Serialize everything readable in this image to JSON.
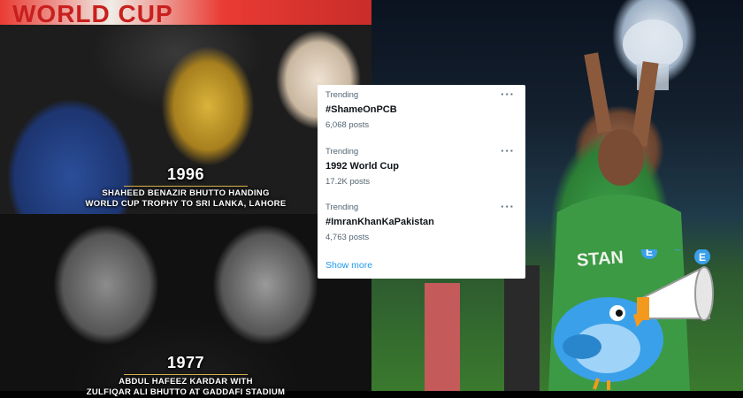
{
  "photos": {
    "top_left": {
      "banner_text": "WORLD CUP",
      "year": "1996",
      "caption_line1": "SHAHEED BENAZIR BHUTTO HANDING",
      "caption_line2": "WORLD CUP TROPHY TO SRI LANKA, LAHORE"
    },
    "bottom_left": {
      "year": "1977",
      "caption_line1": "ABDUL HAFEEZ KARDAR WITH",
      "caption_line2": "ZULFIQAR ALI BHUTTO AT GADDAFI STADIUM"
    },
    "right": {
      "shirt_text": "STAN"
    }
  },
  "trending": {
    "items": [
      {
        "context": "Trending",
        "name": "#ShameOnPCB",
        "count": "6,068 posts"
      },
      {
        "context": "Trending",
        "name": "1992 World Cup",
        "count": "17.2K posts"
      },
      {
        "context": "Trending",
        "name": "#ImranKhanKaPakistan",
        "count": "4,763 posts"
      }
    ],
    "show_more": "Show more",
    "more_icon": "···"
  },
  "sticker": {
    "icon_name": "twitter-bird-megaphone-icon",
    "letters": [
      "E",
      "E",
      "E"
    ]
  },
  "colors": {
    "link_blue": "#1d9bf0",
    "muted_text": "#536471",
    "bird_blue": "#3aa0ea",
    "megaphone_orange": "#f39a1e"
  }
}
